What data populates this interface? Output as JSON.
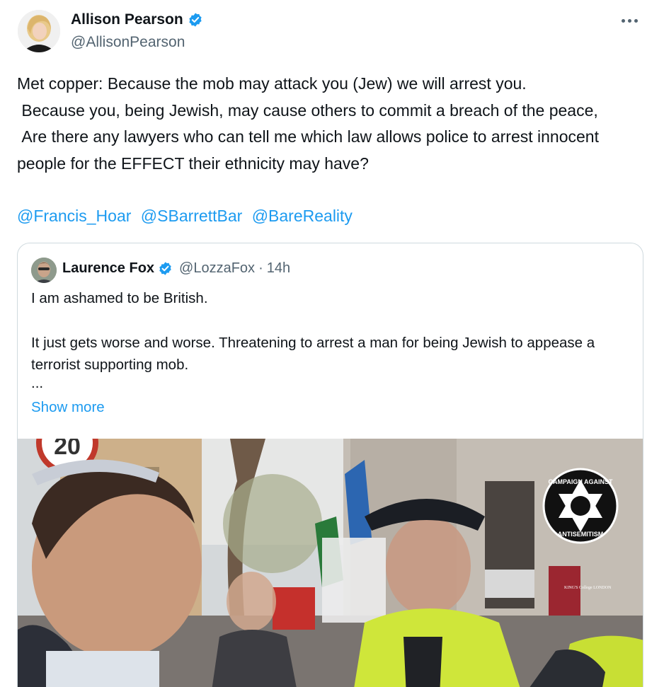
{
  "author": {
    "name": "Allison Pearson",
    "handle": "@AllisonPearson",
    "verified": true
  },
  "tweet": {
    "text": "Met copper: Because the mob may attack you (Jew) we will arrest you.\n Because you, being Jewish, may cause others to commit a breach of the peace,\n Are there any lawyers who can tell me which law allows police to arrest innocent people for the EFFECT their ethnicity may have?",
    "mentions": [
      "@Francis_Hoar",
      "@SBarrettBar",
      "@BareReality"
    ]
  },
  "quote": {
    "name": "Laurence Fox",
    "handle": "@LozzaFox",
    "separator": "·",
    "time": "14h",
    "line1": "I am ashamed to be British.",
    "line2": "It just gets worse and worse. Threatening to arrest a man for being Jewish to appease a terrorist supporting mob.",
    "ellipsis": "...",
    "show_more": "Show more"
  },
  "media": {
    "speed_sign": "20",
    "badge_top": "CAMPAIGN AGAINST",
    "badge_bottom": "ANTISEMITISM",
    "shop_sign": "KING'S College LONDON"
  },
  "colors": {
    "link": "#1d9bf0",
    "secondary": "#536471",
    "border": "#cfd9de",
    "verified": "#1d9bf0"
  }
}
